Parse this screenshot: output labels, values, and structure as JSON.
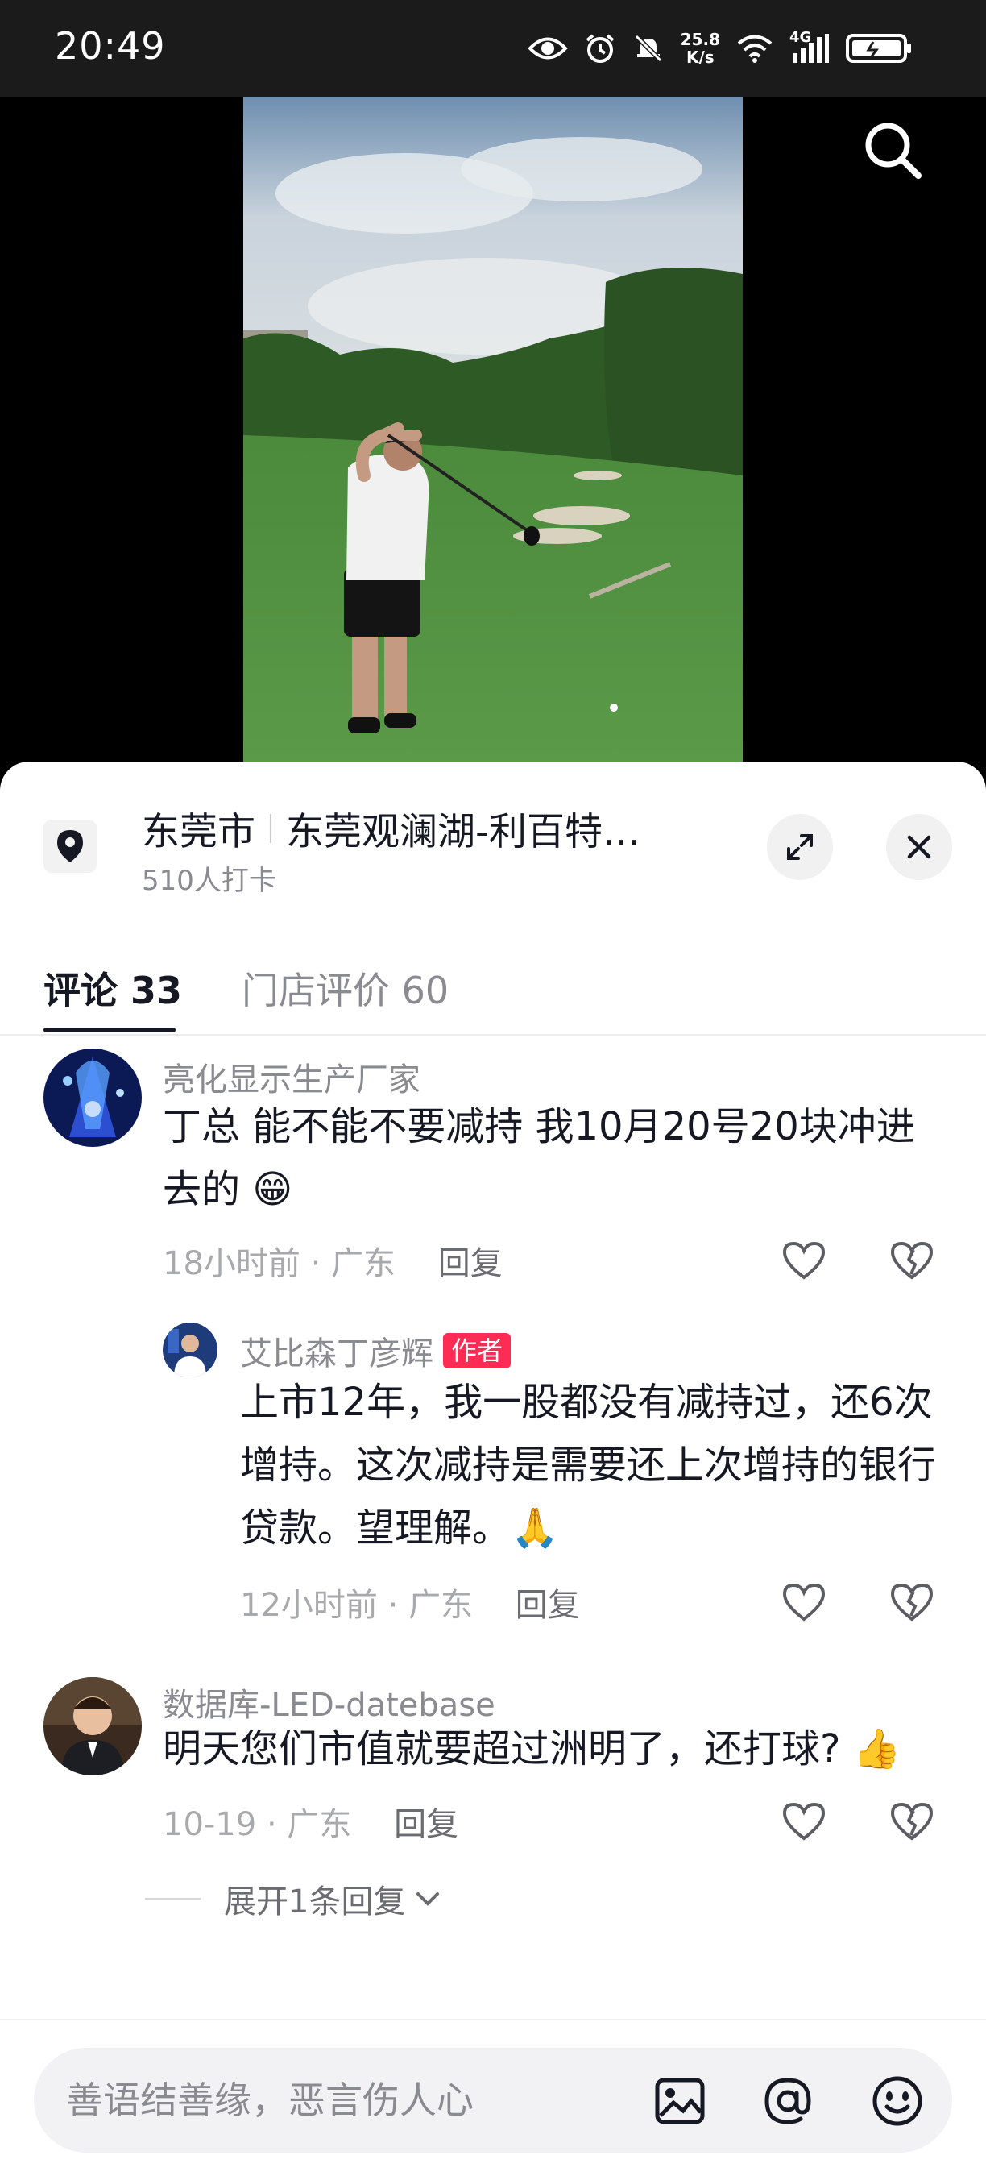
{
  "status_bar": {
    "time": "20:49",
    "net_speed_value": "25.8",
    "net_speed_unit": "K/s",
    "signal_label": "4G"
  },
  "icons": {
    "search": "search-icon",
    "location": "location-pin-icon",
    "expand": "expand-icon",
    "close": "close-icon",
    "like": "heart-icon",
    "dislike": "broken-heart-icon",
    "image": "image-icon",
    "mention": "at-icon",
    "emoji": "emoji-icon"
  },
  "location": {
    "city": "东莞市",
    "place": "东莞观澜湖-利百特…",
    "checkins": "510人打卡"
  },
  "tabs": [
    {
      "label": "评论 33",
      "active": true
    },
    {
      "label": "门店评价 60",
      "active": false
    }
  ],
  "comments": [
    {
      "user": "亮化显示生产厂家",
      "text": "丁总 能不能不要减持 我10月20号20块冲进去的 😁",
      "time": "18小时前",
      "region": "广东",
      "reply_label": "回复"
    },
    {
      "user": "艾比森丁彦辉",
      "badge": "作者",
      "text": "上市12年，我一股都没有减持过，还6次增持。这次减持是需要还上次增持的银行贷款。望理解。🙏",
      "time": "12小时前",
      "region": "广东",
      "reply_label": "回复"
    },
    {
      "user": "数据库-LED-datebase",
      "text": "明天您们市值就要超过洲明了，还打球? 👍",
      "time": "10-19",
      "region": "广东",
      "reply_label": "回复"
    }
  ],
  "expand_replies": "展开1条回复",
  "input": {
    "placeholder": "善语结善缘，恶言伤人心"
  },
  "colors": {
    "accent": "#fe2c55",
    "text_primary": "#161823",
    "text_secondary": "#8a8b91"
  }
}
